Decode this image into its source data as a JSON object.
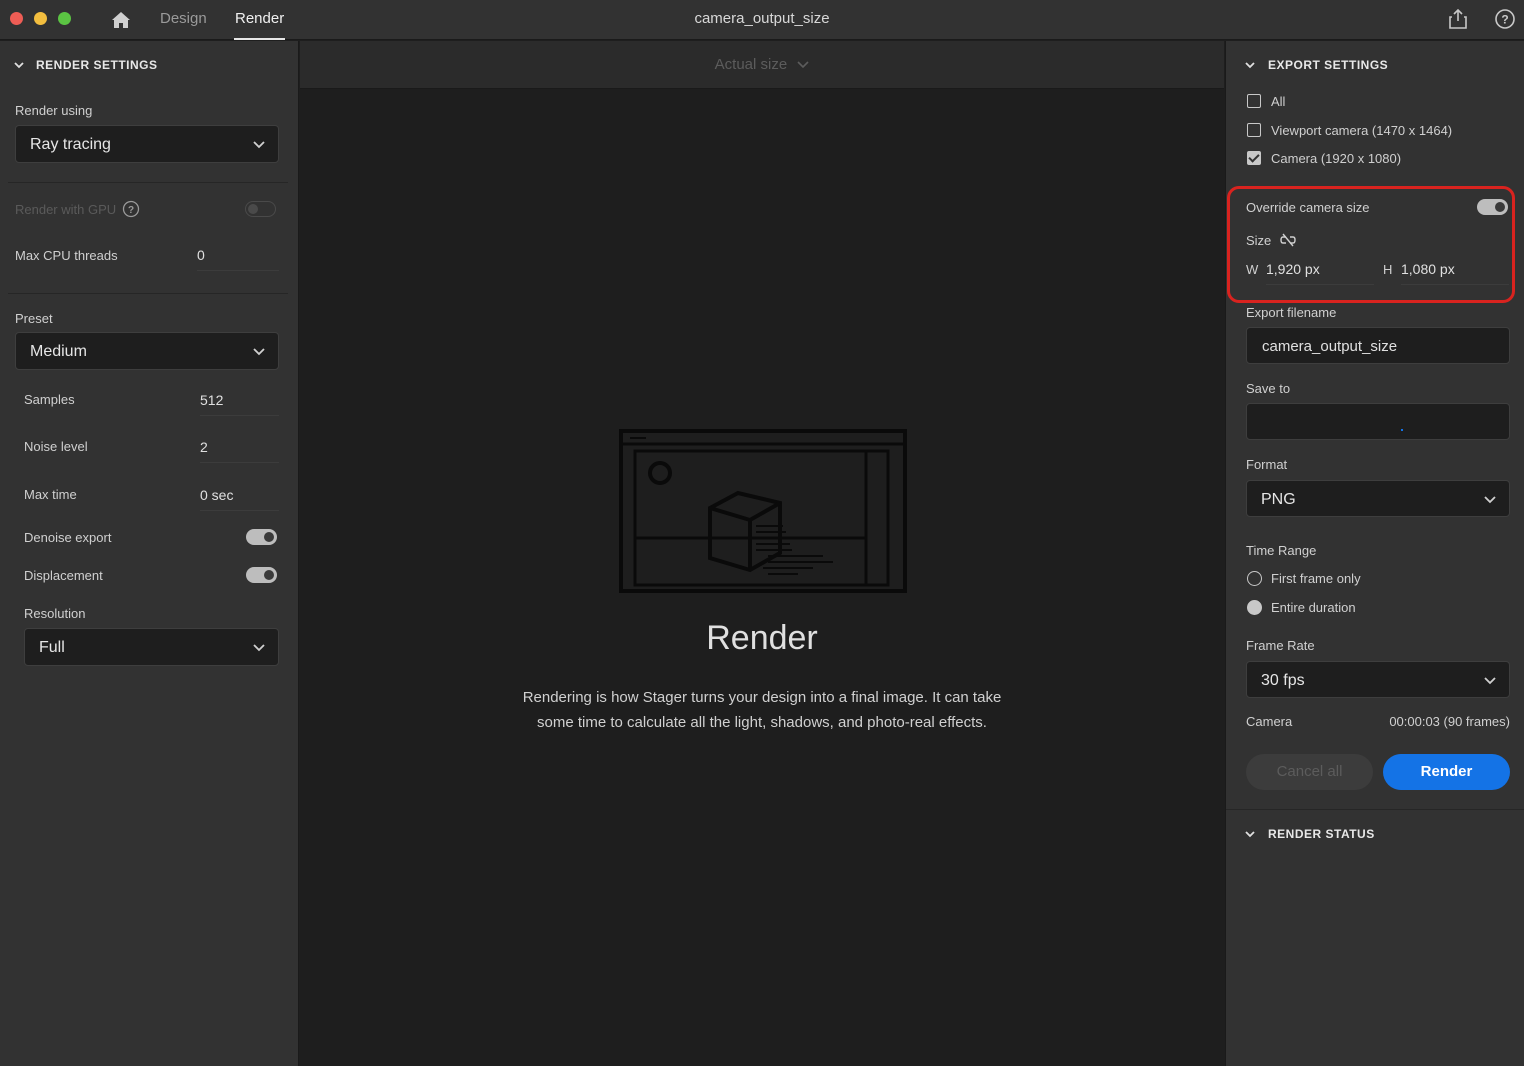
{
  "titlebar": {
    "tabs": [
      "Design",
      "Render"
    ],
    "active_tab": "Render",
    "document_title": "camera_output_size",
    "icons": [
      "home-icon",
      "share-icon",
      "help-icon"
    ]
  },
  "render_settings": {
    "title": "RENDER SETTINGS",
    "render_using_label": "Render using",
    "render_using_value": "Ray tracing",
    "gpu_label": "Render with GPU",
    "gpu_enabled": false,
    "cpu_threads_label": "Max CPU threads",
    "cpu_threads_value": "0",
    "preset_label": "Preset",
    "preset_value": "Medium",
    "samples_label": "Samples",
    "samples_value": "512",
    "noise_label": "Noise level",
    "noise_value": "2",
    "max_time_label": "Max time",
    "max_time_value": "0 sec",
    "denoise_label": "Denoise export",
    "denoise_enabled": true,
    "displacement_label": "Displacement",
    "displacement_enabled": true,
    "resolution_label": "Resolution",
    "resolution_value": "Full"
  },
  "canvas": {
    "zoom_label": "Actual size",
    "heading": "Render",
    "description": "Rendering is how Stager turns your design into a final image. It can take some time to calculate all the light, shadows, and photo-real effects."
  },
  "export_settings": {
    "title": "EXPORT SETTINGS",
    "checkboxes": [
      {
        "label": "All",
        "checked": false
      },
      {
        "label": "Viewport camera (1470 x 1464)",
        "checked": false
      },
      {
        "label": "Camera (1920 x 1080)",
        "checked": true
      }
    ],
    "override_label": "Override camera size",
    "override_enabled": true,
    "size_label": "Size",
    "width_prefix": "W",
    "width_value": "1,920 px",
    "height_prefix": "H",
    "height_value": "1,080 px",
    "filename_label": "Export filename",
    "filename_value": "camera_output_size",
    "save_to_label": "Save to",
    "save_to_value": "",
    "format_label": "Format",
    "format_value": "PNG",
    "time_range_label": "Time Range",
    "time_range_options": [
      {
        "label": "First frame only",
        "selected": false
      },
      {
        "label": "Entire duration",
        "selected": true
      }
    ],
    "frame_rate_label": "Frame Rate",
    "frame_rate_value": "30 fps",
    "camera_label": "Camera",
    "camera_duration": "00:00:03 (90 frames)",
    "cancel_label": "Cancel all",
    "render_label": "Render"
  },
  "render_status": {
    "title": "RENDER STATUS"
  },
  "colors": {
    "accent": "#1473e6",
    "highlight": "#d9231f",
    "panel": "#323232",
    "canvas": "#1e1e1e"
  }
}
